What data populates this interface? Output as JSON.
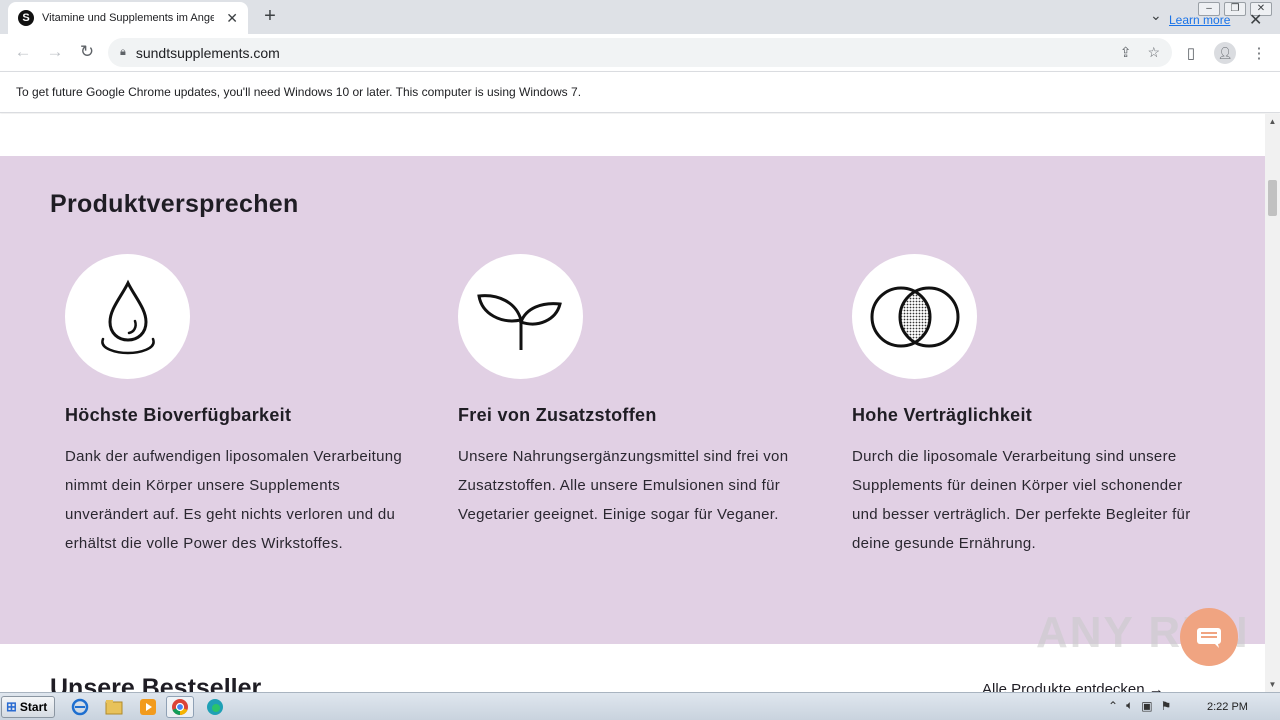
{
  "browser": {
    "tab_title": "Vitamine und Supplements im Angebot",
    "tab_favicon_letter": "S",
    "url": "sundtsupplements.com",
    "infobar_message": "To get future Google Chrome updates, you'll need Windows 10 or later. This computer is using Windows 7.",
    "learn_more": "Learn more"
  },
  "page": {
    "promise_title": "Produktversprechen",
    "features": [
      {
        "icon": "water-drop-icon",
        "title": "Höchste Bioverfügbarkeit",
        "text": "Dank der aufwendigen liposomalen Verarbeitung nimmt dein Körper unsere Supplements unverändert auf. Es geht nichts verloren und du erhältst die volle Power des Wirkstoffes."
      },
      {
        "icon": "sprout-icon",
        "title": "Frei von Zusatzstoffen",
        "text": "Unsere Nahrungsergänzungsmittel sind frei von Zusatzstoffen. Alle unsere Emulsionen sind für Vegetarier geeignet. Einige sogar für Veganer."
      },
      {
        "icon": "overlapping-circles-icon",
        "title": "Hohe Verträglichkeit",
        "text": "Durch die liposomale Verarbeitung sind unsere Supplements für deinen Körper viel schonender und besser verträglich. Der perfekte Begleiter für deine gesunde Ernährung."
      }
    ],
    "bestseller_title": "Unsere Bestseller",
    "all_products_link": "Alle Produkte entdecken"
  },
  "taskbar": {
    "start_label": "Start",
    "clock": "2:22 PM"
  },
  "watermark": "ANY RUN",
  "colors": {
    "promise_bg": "#e1d0e4",
    "chat_button": "#f0a481",
    "link_blue": "#1a73e8"
  }
}
